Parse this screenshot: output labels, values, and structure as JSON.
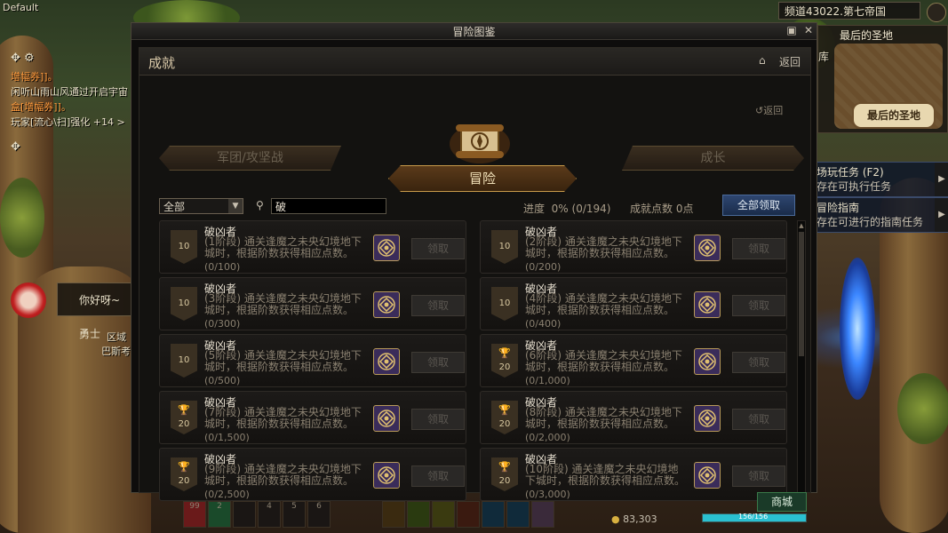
{
  "top_left_label": "Default",
  "channel": "频道43022.第七帝国",
  "minimap": {
    "title": "最后的圣地",
    "location": "最后的圣地",
    "partial_label": "库"
  },
  "quests": [
    {
      "title": "场玩任务 (F2)",
      "subtitle": "存在可执行任务"
    },
    {
      "title": "冒险指南",
      "subtitle": "存在可进行的指南任务"
    }
  ],
  "chat": [
    {
      "text": "增幅券]]。",
      "color": "orange"
    },
    {
      "text": "闲听山雨山风通过开启宇宙",
      "color": "white"
    },
    {
      "text": "盒[增幅券]]。",
      "color": "orange"
    },
    {
      "text": "玩家[流心\\扫]强化 +14 >",
      "color": "white"
    }
  ],
  "npc_greeting": "你好呀~勇士",
  "npc_side_labels": [
    "区域",
    "巴斯考"
  ],
  "dialog": {
    "title": "冒险图鉴",
    "header": "成就",
    "back_label": "返回",
    "back2_label": "返回",
    "tabs": {
      "left": "军团/攻坚战",
      "center": "冒险",
      "right": "成长"
    },
    "filter": {
      "selected": "全部"
    },
    "search": {
      "value": "破"
    },
    "progress_label": "进度",
    "progress_value": "0% (0/194)",
    "points_label": "成就点数",
    "points_value": "0点",
    "claim_all_label": "全部领取",
    "claim_label": "领取",
    "achievements": [
      {
        "name": "破凶者",
        "stage": "(1阶段)",
        "desc": "通关逢魔之未央幻境地下城时，根据阶数获得相应点数。",
        "progress": "(0/100)",
        "points": "10",
        "badge": "plain"
      },
      {
        "name": "破凶者",
        "stage": "(2阶段)",
        "desc": "通关逢魔之未央幻境地下城时，根据阶数获得相应点数。",
        "progress": "(0/200)",
        "points": "10",
        "badge": "plain"
      },
      {
        "name": "破凶者",
        "stage": "(3阶段)",
        "desc": "通关逢魔之未央幻境地下城时，根据阶数获得相应点数。",
        "progress": "(0/300)",
        "points": "10",
        "badge": "plain"
      },
      {
        "name": "破凶者",
        "stage": "(4阶段)",
        "desc": "通关逢魔之未央幻境地下城时，根据阶数获得相应点数。",
        "progress": "(0/400)",
        "points": "10",
        "badge": "plain"
      },
      {
        "name": "破凶者",
        "stage": "(5阶段)",
        "desc": "通关逢魔之未央幻境地下城时，根据阶数获得相应点数。",
        "progress": "(0/500)",
        "points": "10",
        "badge": "plain"
      },
      {
        "name": "破凶者",
        "stage": "(6阶段)",
        "desc": "通关逢魔之未央幻境地下城时，根据阶数获得相应点数。",
        "progress": "(0/1,000)",
        "points": "20",
        "badge": "trophy"
      },
      {
        "name": "破凶者",
        "stage": "(7阶段)",
        "desc": "通关逢魔之未央幻境地下城时，根据阶数获得相应点数。",
        "progress": "(0/1,500)",
        "points": "20",
        "badge": "trophy"
      },
      {
        "name": "破凶者",
        "stage": "(8阶段)",
        "desc": "通关逢魔之未央幻境地下城时，根据阶数获得相应点数。",
        "progress": "(0/2,000)",
        "points": "20",
        "badge": "trophy"
      },
      {
        "name": "破凶者",
        "stage": "(9阶段)",
        "desc": "通关逢魔之未央幻境地下城时，根据阶数获得相应点数。",
        "progress": "(0/2,500)",
        "points": "20",
        "badge": "trophy"
      },
      {
        "name": "破凶者",
        "stage": "(10阶段)",
        "desc": "通关逢魔之未央幻境地下城时，根据阶数获得相应点数。",
        "progress": "(0/3,000)",
        "points": "20",
        "badge": "trophy"
      }
    ]
  },
  "hud": {
    "gold": "83,303",
    "town_label": "商城",
    "hp_text": "156/156",
    "hp_fraction": 1.0,
    "slots": [
      "4",
      "5",
      "6"
    ],
    "item_counts": [
      "99",
      "2"
    ]
  }
}
